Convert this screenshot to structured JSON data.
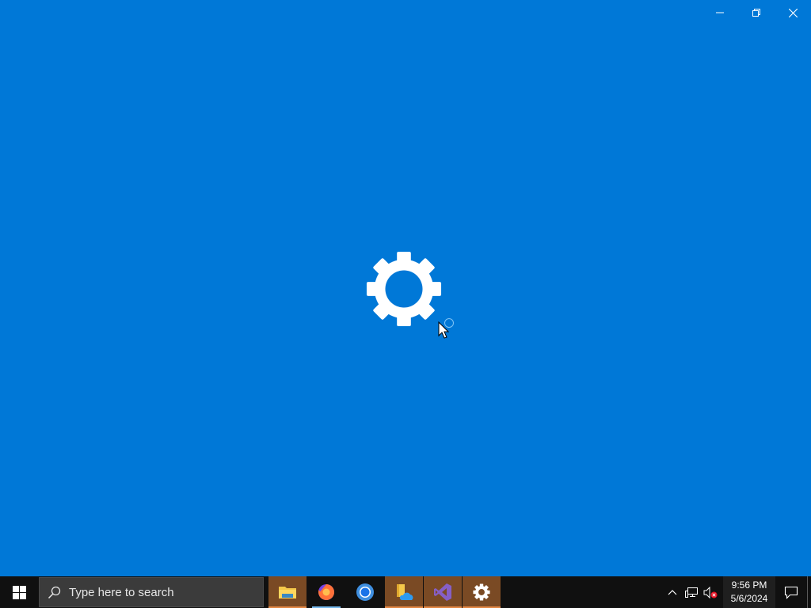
{
  "window": {
    "controls": {
      "minimize": "minimize-icon",
      "restore": "restore-icon",
      "close": "close-icon"
    },
    "splash_icon": "gear-icon",
    "background_color": "#0078d7"
  },
  "taskbar": {
    "start": "windows-logo-icon",
    "search": {
      "placeholder": "Type here to search",
      "icon": "search-icon"
    },
    "apps": [
      {
        "name": "File Explorer",
        "icon": "folder-icon",
        "state": "active"
      },
      {
        "name": "Firefox",
        "icon": "firefox-icon",
        "state": "running"
      },
      {
        "name": "Chrome",
        "icon": "chrome-icon",
        "state": "idle"
      },
      {
        "name": "OneDrive Files",
        "icon": "folder-cloud-icon",
        "state": "active"
      },
      {
        "name": "Visual Studio",
        "icon": "visual-studio-icon",
        "state": "active"
      },
      {
        "name": "Settings",
        "icon": "gear-icon",
        "state": "active"
      }
    ],
    "tray": {
      "icons": [
        "chevron-up-icon",
        "network-icon",
        "volume-muted-icon"
      ],
      "time": "9:56 PM",
      "date": "5/6/2024",
      "notification_icon": "action-center-icon"
    },
    "accent_color": "#e28743"
  }
}
